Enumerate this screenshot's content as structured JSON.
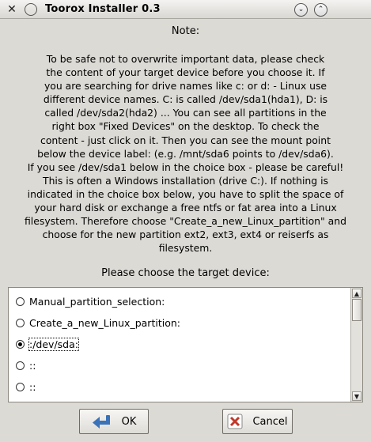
{
  "window": {
    "title": "Toorox Installer 0.3",
    "icons": [
      "close-x-icon",
      "circle-menu-icon",
      "chevron-down-icon",
      "chevron-up-icon"
    ]
  },
  "note": {
    "heading": "Note:",
    "body": "To be safe not to overwrite important data, please check\nthe content of your target device before you choose it. If\nyou are searching for drive names like c: or d: - Linux use\ndifferent device names. C: is called /dev/sda1(hda1), D: is\ncalled /dev/sda2(hda2) ... You can see all partitions in the\nright box \"Fixed Devices\" on the desktop. To check the\ncontent - just click on it. Then you can see the mount point\nbelow the device label: (e.g. /mnt/sda6 points to /dev/sda6).\nIf you see /dev/sda1 below in the choice box - please be careful!\nThis is often a Windows installation (drive C:). If nothing is\nindicated in the choice box below, you have to split the space of\nyour hard disk or exchange a free ntfs or fat area into a Linux\nfilesystem. Therefore choose \"Create_a_new_Linux_partition\" and\nchoose for the new partition ext2, ext3, ext4 or reiserfs as\nfilesystem."
  },
  "prompt": "Please choose the target device:",
  "options": [
    {
      "label": "Manual_partition_selection:",
      "selected": false
    },
    {
      "label": "Create_a_new_Linux_partition:",
      "selected": false
    },
    {
      "label": ":/dev/sda:",
      "selected": true
    },
    {
      "label": "::",
      "selected": false
    },
    {
      "label": "::",
      "selected": false
    }
  ],
  "buttons": {
    "ok": "OK",
    "cancel": "Cancel"
  },
  "colors": {
    "window_bg": "#dcdad5",
    "list_bg": "#ffffff",
    "cancel_icon": "#c0392b",
    "ok_icon": "#3a73b8"
  }
}
